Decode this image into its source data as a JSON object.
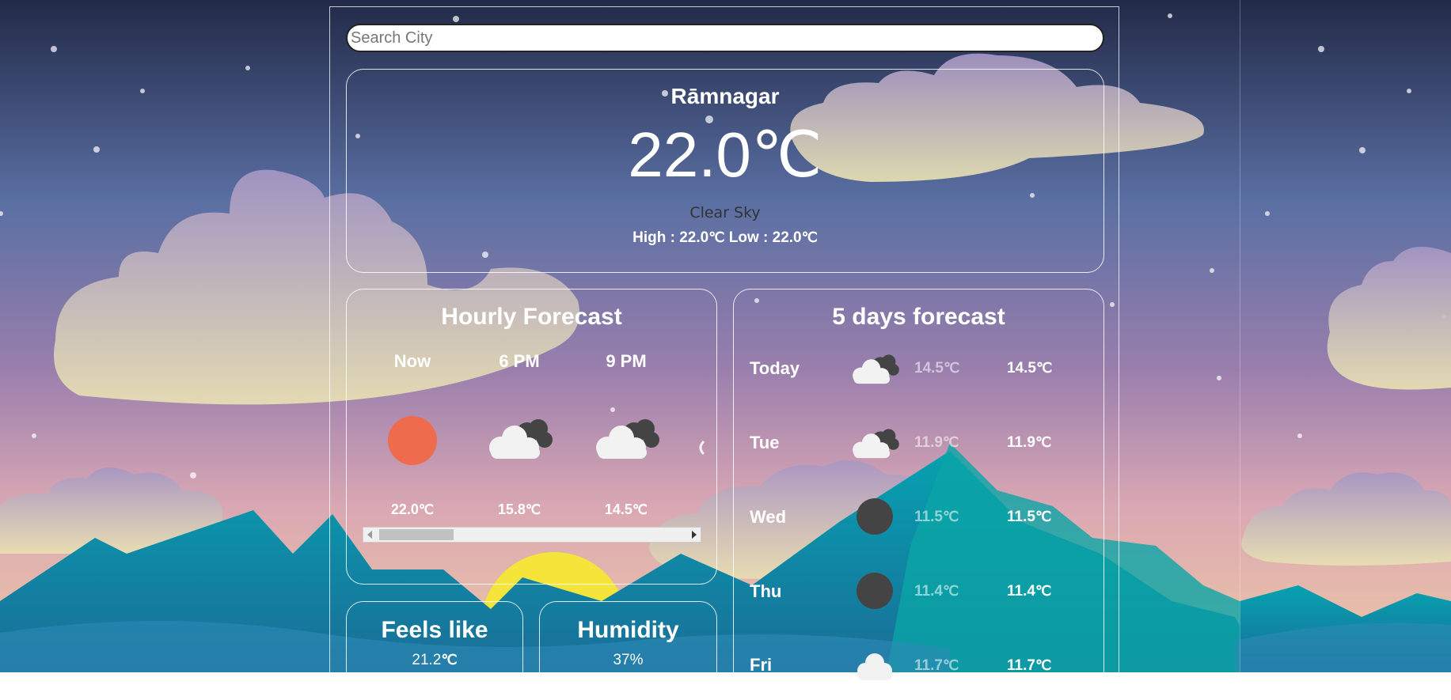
{
  "search": {
    "placeholder": "Search City"
  },
  "current": {
    "city": "Rāmnagar",
    "temp": "22.0",
    "unit": "℃",
    "condition": "Clear Sky",
    "high_label": "High :",
    "high": "22.0",
    "low_label": "Low :",
    "low": "22.0"
  },
  "hourly": {
    "title": "Hourly Forecast",
    "items": [
      {
        "time": "Now",
        "icon": "sun-icon",
        "temp": "22.0"
      },
      {
        "time": "6 PM",
        "icon": "cloudy-icon",
        "temp": "15.8"
      },
      {
        "time": "9 PM",
        "icon": "cloudy-icon",
        "temp": "14.5"
      }
    ]
  },
  "daily": {
    "title": "5 days forecast",
    "items": [
      {
        "day": "Today",
        "icon": "cloudy-icon",
        "low": "14.5",
        "high": "14.5"
      },
      {
        "day": "Tue",
        "icon": "cloudy-icon",
        "low": "11.9",
        "high": "11.9"
      },
      {
        "day": "Wed",
        "icon": "moon-icon",
        "low": "11.5",
        "high": "11.5"
      },
      {
        "day": "Thu",
        "icon": "moon-icon",
        "low": "11.4",
        "high": "11.4"
      },
      {
        "day": "Fri",
        "icon": "cloud-icon",
        "low": "11.7",
        "high": "11.7"
      }
    ]
  },
  "feels_like": {
    "title": "Feels like",
    "value": "21.2"
  },
  "humidity": {
    "title": "Humidity",
    "value": "37%"
  },
  "colors": {
    "sky_top": "#222a48",
    "sky_mid": "#5a6fa3",
    "sky_low": "#d9a7b3",
    "mountain": "#1796a8",
    "sun_icon": "#ee6b4d",
    "cloud_dark": "#444444"
  }
}
